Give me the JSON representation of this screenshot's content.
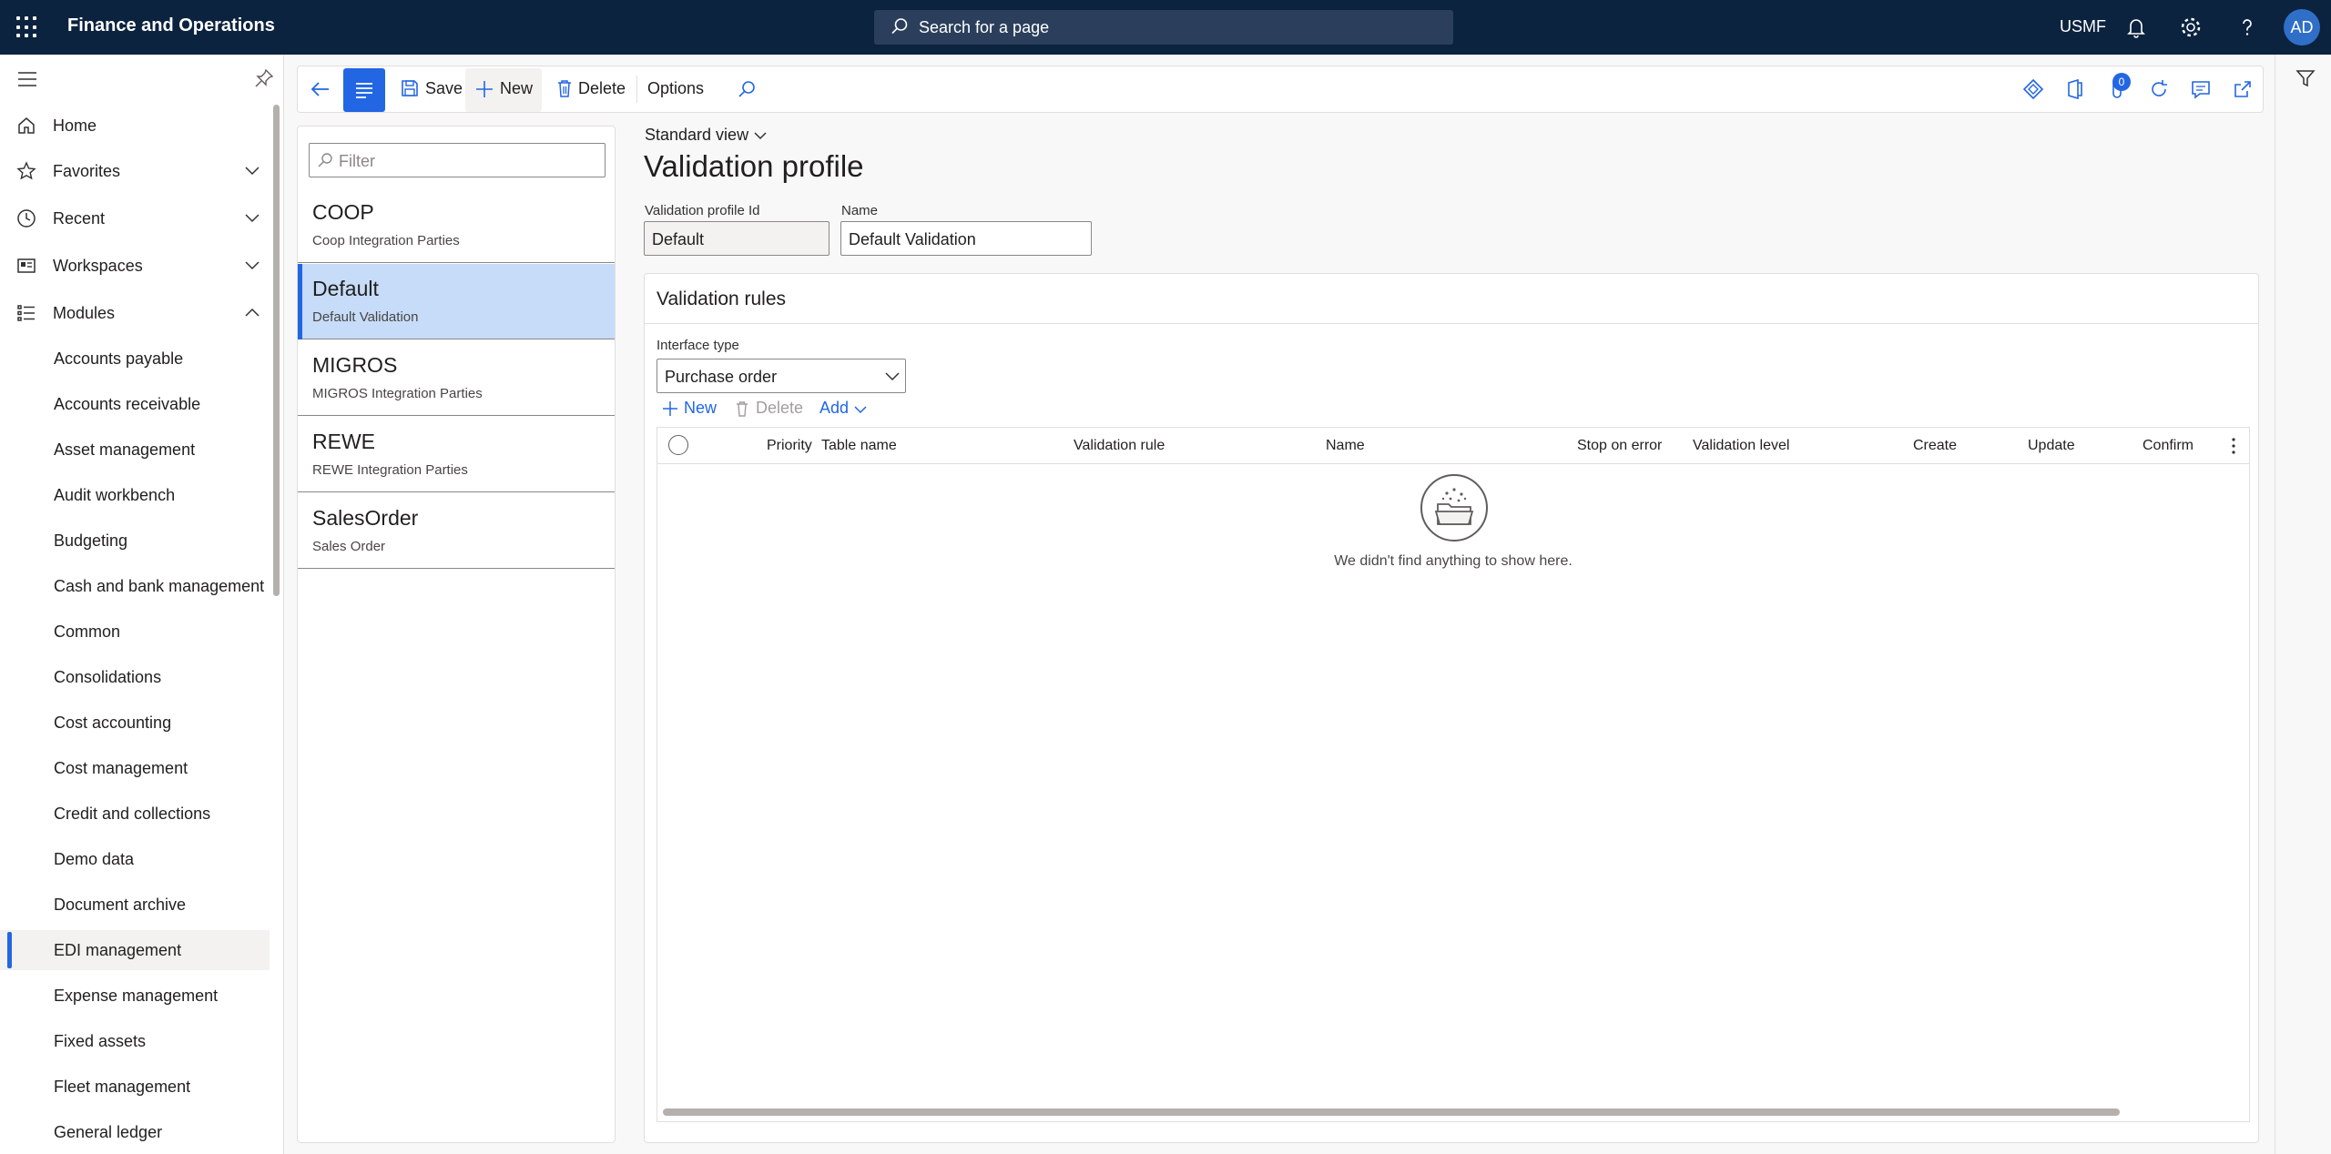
{
  "app": {
    "title": "Finance and Operations",
    "company": "USMF",
    "avatar_initials": "AD",
    "notification_count": "0"
  },
  "search": {
    "placeholder": "Search for a page"
  },
  "nav": {
    "top_items": [
      {
        "label": "Home",
        "icon": "home-icon"
      },
      {
        "label": "Favorites",
        "icon": "star-icon"
      },
      {
        "label": "Recent",
        "icon": "clock-icon"
      },
      {
        "label": "Workspaces",
        "icon": "workspace-icon"
      },
      {
        "label": "Modules",
        "icon": "list-icon"
      }
    ],
    "modules": [
      "Accounts payable",
      "Accounts receivable",
      "Asset management",
      "Audit workbench",
      "Budgeting",
      "Cash and bank management",
      "Common",
      "Consolidations",
      "Cost accounting",
      "Cost management",
      "Credit and collections",
      "Demo data",
      "Document archive",
      "EDI management",
      "Expense management",
      "Fixed assets",
      "Fleet management",
      "General ledger"
    ],
    "active_module": "EDI management"
  },
  "actions": {
    "save": "Save",
    "new": "New",
    "delete": "Delete",
    "options": "Options"
  },
  "list": {
    "filter_placeholder": "Filter",
    "items": [
      {
        "title": "COOP",
        "subtitle": "Coop Integration Parties"
      },
      {
        "title": "Default",
        "subtitle": "Default Validation"
      },
      {
        "title": "MIGROS",
        "subtitle": "MIGROS Integration Parties"
      },
      {
        "title": "REWE",
        "subtitle": "REWE Integration Parties"
      },
      {
        "title": "SalesOrder",
        "subtitle": "Sales Order"
      }
    ],
    "selected_index": 1
  },
  "details": {
    "view_name": "Standard view",
    "page_title": "Validation profile",
    "id_label": "Validation profile Id",
    "id_value": "Default",
    "name_label": "Name",
    "name_value": "Default Validation"
  },
  "rules": {
    "section_title": "Validation rules",
    "interface_type_label": "Interface type",
    "interface_type_value": "Purchase order",
    "btn_new": "New",
    "btn_delete": "Delete",
    "btn_add": "Add",
    "columns": [
      "Priority",
      "Table name",
      "Validation rule",
      "Name",
      "Stop on error",
      "Validation level",
      "Create",
      "Update",
      "Confirm"
    ],
    "empty_message": "We didn't find anything to show here."
  },
  "colors": {
    "topbar": "#0c2340",
    "accent": "#2266e3",
    "selected_row": "#c7dcf8"
  }
}
